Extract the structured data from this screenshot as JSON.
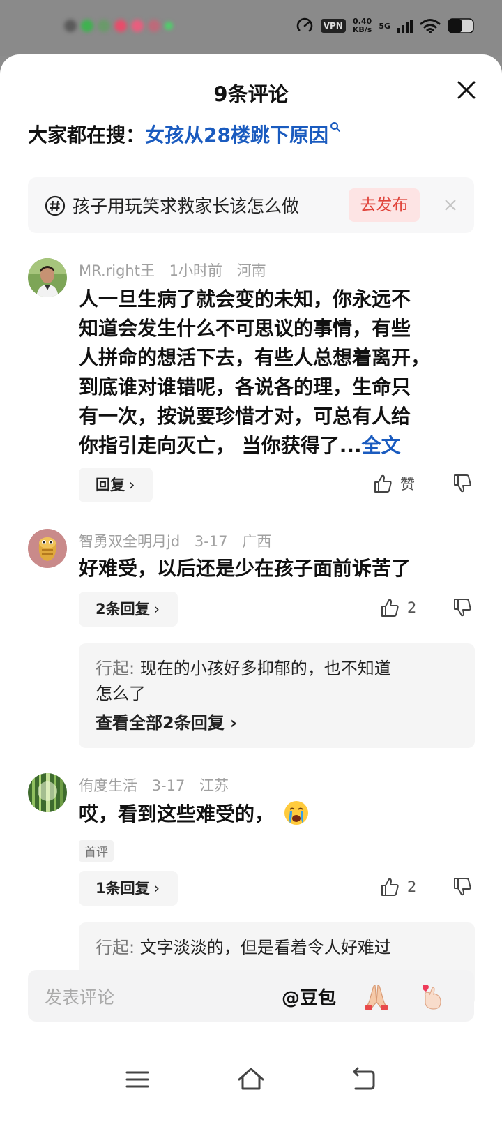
{
  "status_bar": {
    "vpn": "VPN",
    "speed_value": "0.40",
    "speed_unit": "KB/s",
    "network": "5G"
  },
  "sheet": {
    "title": "9条评论",
    "hot_search_label": "大家都在搜：",
    "hot_search_query": "女孩从28楼跳下原因",
    "topic_text": "孩子用玩笑求救家长该怎么做",
    "publish_label": "去发布"
  },
  "comments": [
    {
      "user": "MR.right王",
      "time": "1小时前",
      "location": "河南",
      "lines": [
        "人一旦生病了就会变的未知，你永远不",
        "知道会发生什么不可思议的事情，有些",
        "人拼命的想活下去，有些人总想着离开，",
        "到底谁对谁错呢，各说各的理，生命只",
        "有一次，按说要珍惜才对，可总有人给",
        "你指引走向灭亡， 当你获得了..."
      ],
      "full_text_link": "全文",
      "reply_label": "回复",
      "like_label": "赞"
    },
    {
      "user": "智勇双全明月jd",
      "time": "3-17",
      "location": "广西",
      "text": "好难受，以后还是少在孩子面前诉苦了",
      "reply_label": "2条回复",
      "like_count": "2",
      "sub_reply": {
        "author": "行起: ",
        "line1": "现在的小孩好多抑郁的，也不知道",
        "line2": "怎么了",
        "view_all": "查看全部2条回复"
      }
    },
    {
      "user": "侑度生活",
      "time": "3-17",
      "location": "江苏",
      "text": "哎，看到这些难受的，",
      "badge": "首评",
      "reply_label": "1条回复",
      "like_count": "2",
      "sub_reply": {
        "author": "行起: ",
        "line1": "文字淡淡的，但是看着令人好难过"
      }
    }
  ],
  "input": {
    "placeholder": "发表评论",
    "mention": "@豆包"
  },
  "icons": {
    "close": "close-icon",
    "search": "search-icon",
    "hashtag": "hashtag-icon",
    "like": "thumbs-up-icon",
    "dislike": "thumbs-down-icon",
    "crying_emoji": "crying-face-emoji",
    "pray_emoji": "folded-hands-emoji",
    "heart_hand_emoji": "finger-heart-emoji",
    "nav_menu": "menu-icon",
    "nav_home": "home-icon",
    "nav_back": "back-icon"
  },
  "colors": {
    "link_blue": "#1a5bbf",
    "publish_red": "#e0433a",
    "publish_bg": "#fde4e4"
  }
}
